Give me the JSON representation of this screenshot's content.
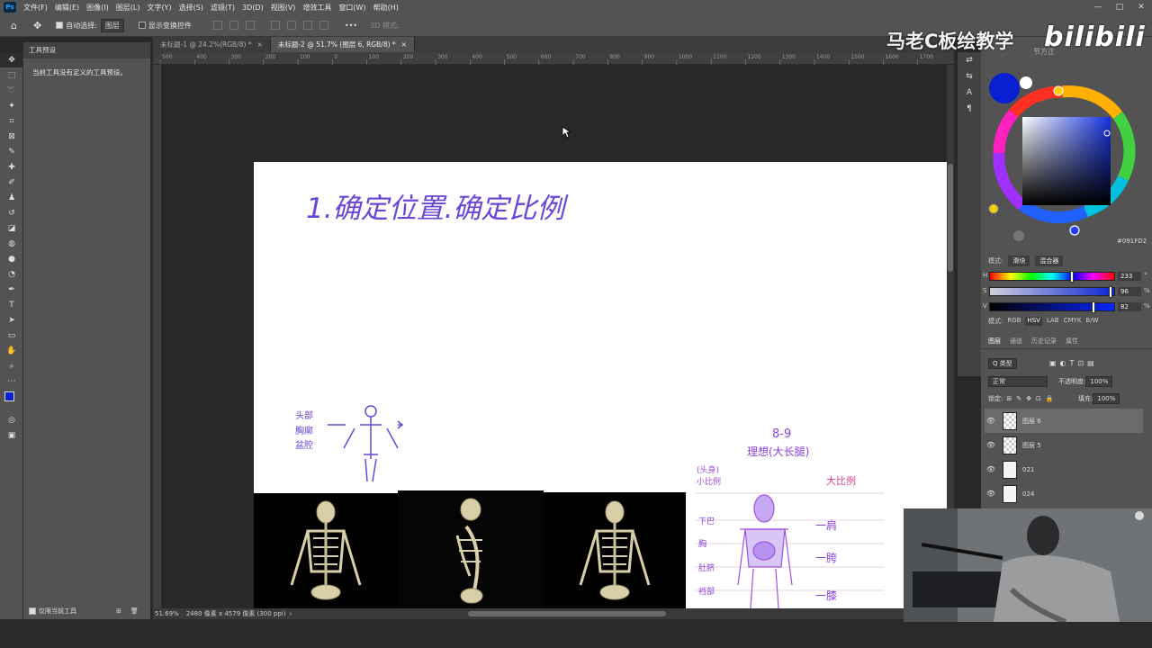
{
  "menubar": {
    "items": [
      "文件(F)",
      "编辑(E)",
      "图像(I)",
      "图层(L)",
      "文字(Y)",
      "选择(S)",
      "滤镜(T)",
      "3D(D)",
      "视图(V)",
      "增效工具",
      "窗口(W)",
      "帮助(H)"
    ],
    "window_controls": [
      "—",
      "□",
      "✕"
    ]
  },
  "options": {
    "auto_select_label": "自动选择:",
    "auto_select_value": "图层",
    "show_transform_label": "显示变换控件",
    "mode_3d_label": "3D 模式:",
    "more": "•••"
  },
  "tabs": [
    {
      "label": "未标题-1 @ 24.2%(RGB/8) *",
      "close": "×"
    },
    {
      "label": "未标题-2 @ 51.7% (图层 6, RGB/8) *",
      "close": "×"
    }
  ],
  "preset_panel": {
    "title": "工具预设",
    "message": "当前工具没有定义的工具预设。",
    "footer_label": "仅限当前工具"
  },
  "ruler": {
    "top_ticks": [
      "500",
      "400",
      "300",
      "200",
      "100",
      "0",
      "100",
      "200",
      "300",
      "400",
      "500",
      "600",
      "700",
      "800",
      "900",
      "1000",
      "1100",
      "1200",
      "1300",
      "1400",
      "1500",
      "1600",
      "1700"
    ]
  },
  "status": {
    "zoom": "51.69%",
    "doc_info": "2480 像素 x 4579 像素 (300 ppi)"
  },
  "watermark": {
    "text": "马老C板绘教学",
    "logo": "bilibili",
    "overlay": "节方正"
  },
  "color_panel": {
    "hex": "#091FD2",
    "mode_label": "模式:",
    "mode_slider": "滑块",
    "mode_mixer": "混合器",
    "h_label": "H",
    "h_value": "233",
    "s_label": "S",
    "s_value": "96",
    "v_label": "V",
    "v_value": "82",
    "pct": "%",
    "model_label": "模式:",
    "models": [
      "RGB",
      "HSV",
      "LAB",
      "CMYK",
      "B/W"
    ],
    "active_model": "HSV",
    "colors": {
      "foreground": "#091fd2",
      "background": "#ffffff"
    },
    "levels": {
      "h": 233,
      "s": 96,
      "v": 82
    }
  },
  "layers_panel": {
    "tabs": [
      "图层",
      "通道",
      "历史记录",
      "属性"
    ],
    "filter_label": "Q 类型",
    "blend_mode": "正常",
    "opacity_label": "不透明度:",
    "opacity_value": "100%",
    "lock_label": "锁定:",
    "fill_label": "填充:",
    "fill_value": "100%",
    "layers": [
      {
        "name": "图层 6",
        "active": true
      },
      {
        "name": "图层 5",
        "active": false
      },
      {
        "name": "021",
        "active": false
      },
      {
        "name": "024",
        "active": false
      }
    ]
  },
  "canvas": {
    "heading": "1.确定位置.确定比例",
    "left_labels": [
      "头部",
      "胸廓",
      "盆腔"
    ],
    "right_numbers": "8-9",
    "right_title": "理想(大长腿)",
    "side_notes": [
      "(头身)",
      "小比例",
      "大比例"
    ],
    "body_marks": [
      "下巴",
      "胸",
      "肚脐",
      "裆部"
    ],
    "right_marks": [
      "一肩",
      "一胯",
      "一膝"
    ]
  }
}
